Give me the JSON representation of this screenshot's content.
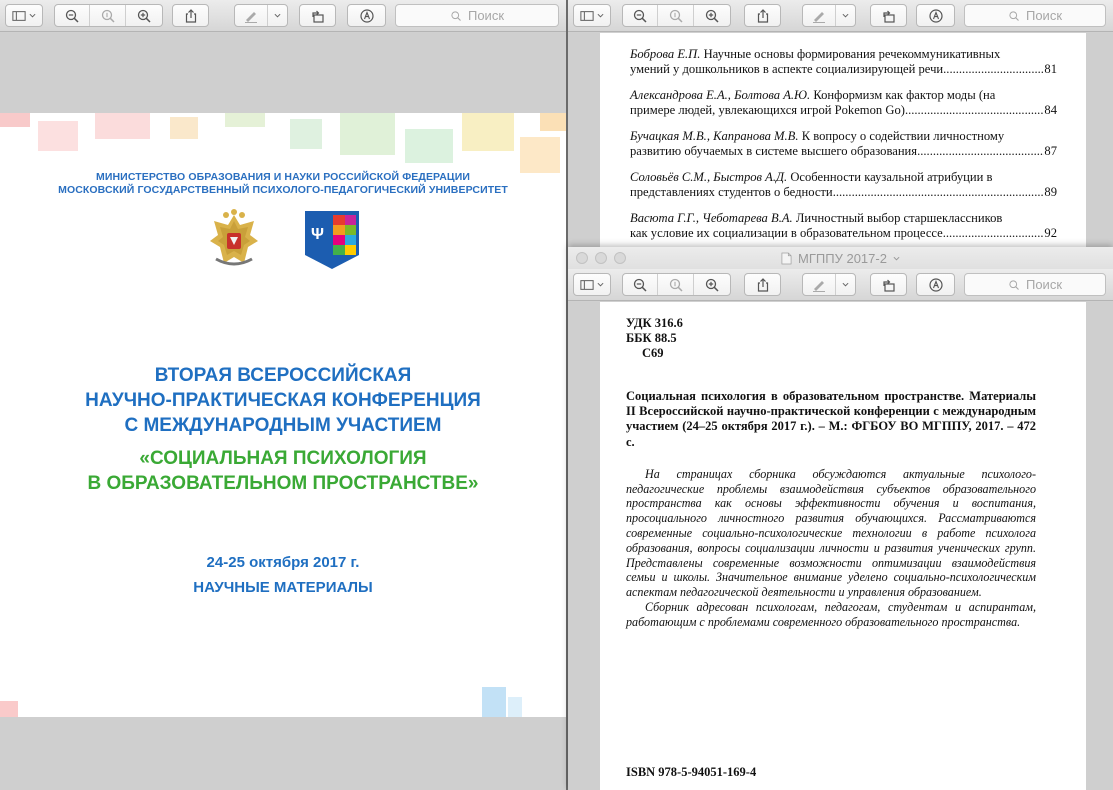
{
  "search_placeholder": "Поиск",
  "window3_title": "МГППУ 2017-2",
  "cover": {
    "ministry_line1": "МИНИСТЕРСТВО ОБРАЗОВАНИЯ И НАУКИ РОССИЙСКОЙ ФЕДЕРАЦИИ",
    "ministry_line2": "МОСКОВСКИЙ ГОСУДАРСТВЕННЫЙ ПСИХОЛОГО-ПЕДАГОГИЧЕСКИЙ УНИВЕРСИТЕТ",
    "title_line1": "ВТОРАЯ ВСЕРОССИЙСКАЯ",
    "title_line2": "НАУЧНО-ПРАКТИЧЕСКАЯ КОНФЕРЕНЦИЯ",
    "title_line3": "С МЕЖДУНАРОДНЫМ УЧАСТИЕМ",
    "subtitle_line1": "«СОЦИАЛЬНАЯ ПСИХОЛОГИЯ",
    "subtitle_line2": "В ОБРАЗОВАТЕЛЬНОМ ПРОСТРАНСТВЕ»",
    "date": "24-25 октября 2017 г.",
    "materials": "НАУЧНЫЕ МАТЕРИАЛЫ",
    "colors": {
      "blue": "#1f6fc1",
      "green": "#3aa935"
    }
  },
  "toc": [
    {
      "authors": "Боброва Е.П.",
      "line1": "Научные основы формирования речекоммуникативных",
      "line2": "умений у дошкольников в аспекте социализирующей речи",
      "page": "81"
    },
    {
      "authors": "Александрова Е.А., Болтова А.Ю.",
      "line1": "Конформизм как фактор моды (на",
      "line2": "примере людей, увлекающихся игрой Pokemon Go)",
      "page": "84"
    },
    {
      "authors": "Бучацкая М.В., Капранова М.В.",
      "line1": "К вопросу о содействии личностному",
      "line2": "развитию обучаемых в системе высшего образования",
      "page": "87"
    },
    {
      "authors": "Соловьёв С.М., Быстров А.Д.",
      "line1": "Особенности каузальной атрибуции в",
      "line2": "представлениях студентов о бедности",
      "page": "89"
    },
    {
      "authors": "Васюта Г.Г., Чеботарева В.А.",
      "line1": "Личностный выбор старшеклассников",
      "line2": "как условие их социализации в образовательном процессе",
      "page": "92"
    }
  ],
  "imprint": {
    "udk": "УДК 316.6",
    "bbk": "ББК 88.5",
    "code": "С69",
    "citation": "Социальная психология в образовательном пространстве. Материалы II Всероссийской научно-практической конференции с международным участием (24–25 октября 2017 г.). – М.: ФГБОУ ВО МГППУ, 2017. – 472 с.",
    "annotation1": "На страницах сборника обсуждаются актуальные психолого-педагогические проблемы взаимодействия субъектов образовательного пространства как основы эффективности обучения и воспитания, просоциального личностного развития обучающихся. Рассматриваются современные социально-психологические технологии в работе психолога образования, вопросы социализации личности и развития ученических групп. Представлены современные возможности оптимизации взаимодействия семьи и школы. Значительное внимание уделено социально-психологическим аспектам педагогической деятельности и управления образованием.",
    "annotation2": "Сборник адресован психологам, педагогам, студентам и аспирантам, работающим с проблемами современного образовательного пространства.",
    "isbn": "ISBN 978-5-94051-169-4"
  }
}
